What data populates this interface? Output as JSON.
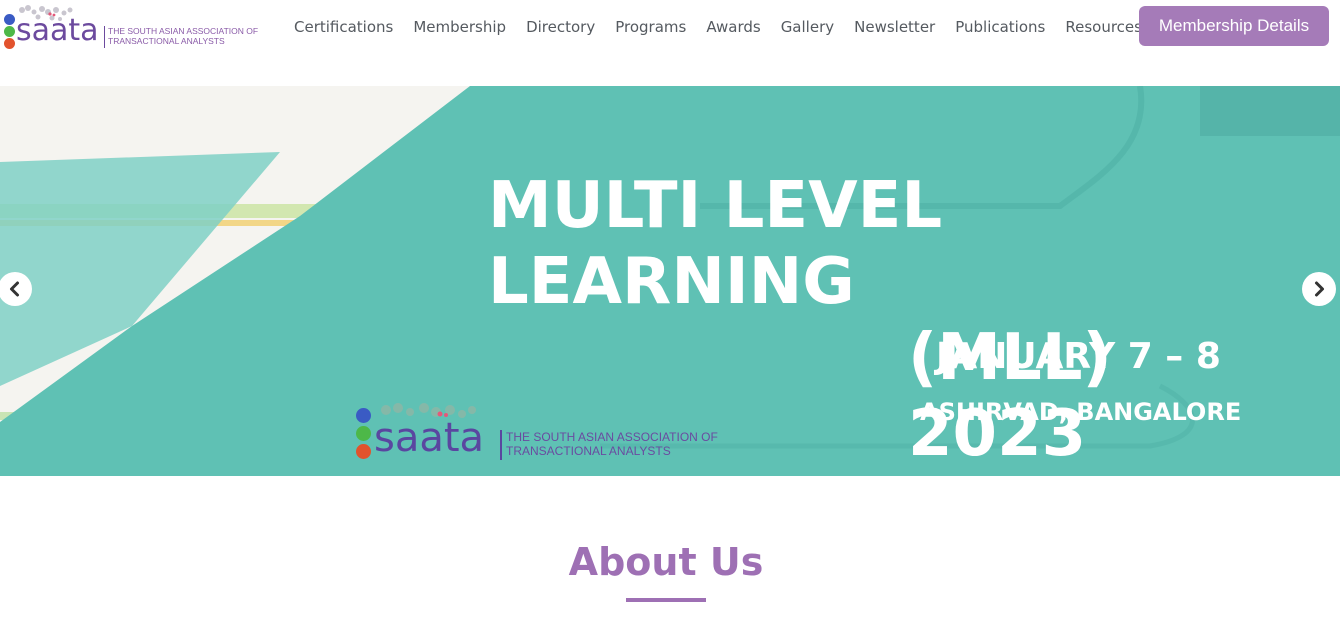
{
  "brand": {
    "word": "saata",
    "tagline_line1": "THE SOUTH ASIAN ASSOCIATION OF",
    "tagline_line2": "TRANSACTIONAL ANALYSTS",
    "dot_colors": [
      "#3a5bc4",
      "#4db848",
      "#e2532d"
    ],
    "accent": "#a57bb8"
  },
  "nav": {
    "items": [
      "Certifications",
      "Membership",
      "Directory",
      "Programs",
      "Awards",
      "Gallery",
      "Newsletter",
      "Publications",
      "Resources"
    ],
    "cta_label": "Membership Details"
  },
  "hero": {
    "title_line1": "MULTI LEVEL LEARNING",
    "title_line2": "(MLL) 2023",
    "date": "JANUARY 7 – 8",
    "venue": "ASHIRVAD, BANGALORE",
    "logo_word": "saata",
    "logo_tag_line1": "THE SOUTH ASIAN ASSOCIATION OF",
    "logo_tag_line2": "TRANSACTIONAL ANALYSTS",
    "bg_color": "#5fc1b4",
    "prev_icon": "chevron-left-icon",
    "next_icon": "chevron-right-icon"
  },
  "about": {
    "heading": "About Us",
    "heading_color": "#9e70b4"
  }
}
